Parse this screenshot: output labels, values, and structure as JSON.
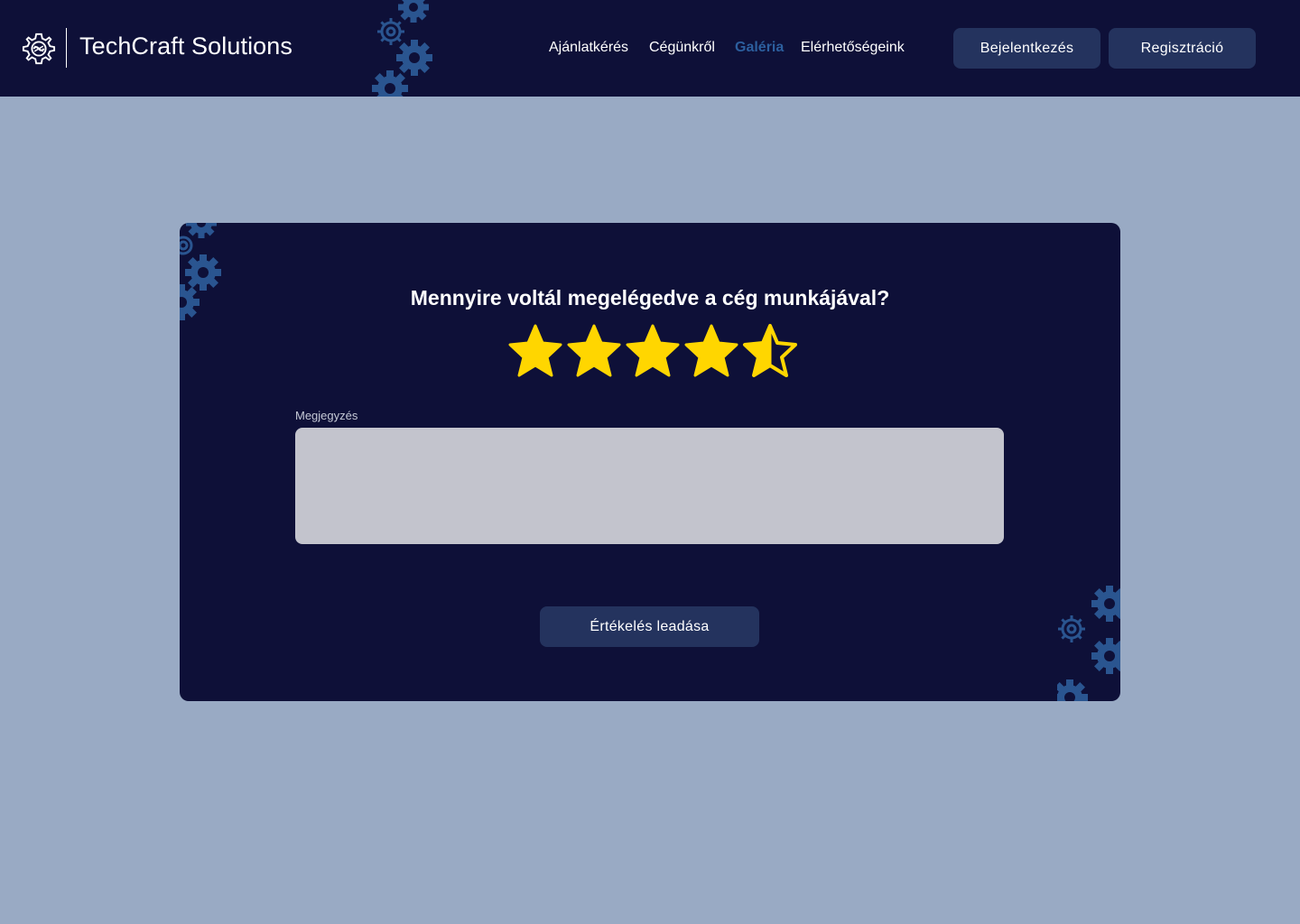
{
  "brand": {
    "name": "TechCraft Solutions",
    "logo_icon": "gear-brain-icon"
  },
  "nav": {
    "items": [
      {
        "label": "Ajánlatkérés",
        "active": false
      },
      {
        "label": "Cégünkről",
        "active": false
      },
      {
        "label": "Galéria",
        "active": true
      },
      {
        "label": "Elérhetőségeink",
        "active": false
      }
    ]
  },
  "auth": {
    "login_label": "Bejelentkezés",
    "register_label": "Regisztráció"
  },
  "rating": {
    "question": "Mennyire voltál megelégedve a cég munkájával?",
    "value": 4.5,
    "max": 5,
    "star_icon": "star-icon"
  },
  "comment": {
    "label": "Megjegyzés",
    "value": "",
    "placeholder": ""
  },
  "submit": {
    "label": "Értékelés leadása"
  },
  "colors": {
    "page_background": "#99aac4",
    "header_background": "#0e1038",
    "card_background": "#0e1038",
    "button_background": "#24335e",
    "active_nav": "#2c5f9e",
    "gear_decoration": "#2a5590",
    "star": "#ffd600",
    "textarea_background": "#c3c4cd"
  }
}
